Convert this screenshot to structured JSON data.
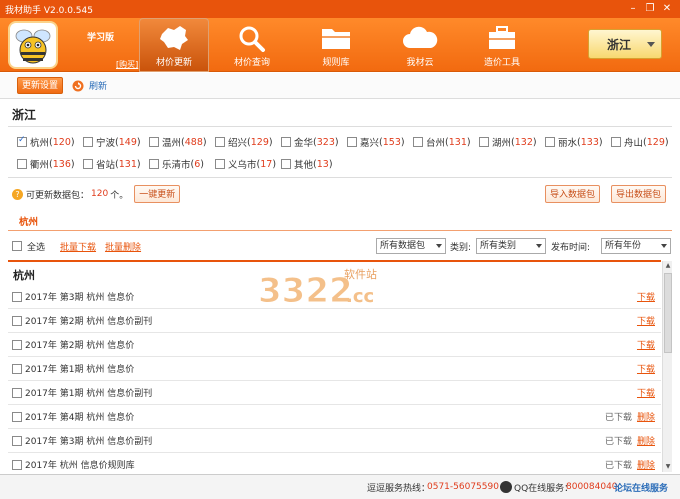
{
  "window": {
    "title": "我材助手 V2.0.0.545"
  },
  "header": {
    "edition": "学习版",
    "buy_label": "[购买]",
    "nav": [
      {
        "label": "材价更新",
        "icon": "china-map-icon",
        "active": true
      },
      {
        "label": "材价查询",
        "icon": "magnifier-icon",
        "active": false
      },
      {
        "label": "规则库",
        "icon": "folder-icon",
        "active": false
      },
      {
        "label": "我材云",
        "icon": "cloud-icon",
        "active": false
      },
      {
        "label": "造价工具",
        "icon": "toolbox-icon",
        "active": false
      }
    ],
    "region": "浙江"
  },
  "toolbar": {
    "settings_label": "更新设置",
    "refresh_label": "刷新"
  },
  "province": {
    "name": "浙江",
    "cities": [
      {
        "name": "杭州",
        "count": "120",
        "checked": true
      },
      {
        "name": "宁波",
        "count": "149",
        "checked": false
      },
      {
        "name": "温州",
        "count": "488",
        "checked": false
      },
      {
        "name": "绍兴",
        "count": "129",
        "checked": false
      },
      {
        "name": "金华",
        "count": "323",
        "checked": false
      },
      {
        "name": "嘉兴",
        "count": "153",
        "checked": false
      },
      {
        "name": "台州",
        "count": "131",
        "checked": false
      },
      {
        "name": "湖州",
        "count": "132",
        "checked": false
      },
      {
        "name": "丽水",
        "count": "133",
        "checked": false
      },
      {
        "name": "舟山",
        "count": "129",
        "checked": false
      },
      {
        "name": "衢州",
        "count": "136",
        "checked": false
      },
      {
        "name": "省站",
        "count": "131",
        "checked": false
      },
      {
        "name": "乐清市",
        "count": "6",
        "checked": false
      },
      {
        "name": "义乌市",
        "count": "17",
        "checked": false
      },
      {
        "name": "其他",
        "count": "13",
        "checked": false
      }
    ]
  },
  "package": {
    "prefix": "可更新数据包：",
    "count": "120",
    "suffix": "个。",
    "update_all_label": "一键更新",
    "import_label": "导入数据包",
    "export_label": "导出数据包"
  },
  "city_tab": "杭州",
  "filters": {
    "select_all_label": "全选",
    "batch_download_label": "批量下载",
    "batch_delete_label": "批量删除",
    "package_filter": "所有数据包",
    "category_label": "类别:",
    "category_value": "所有类别",
    "date_label": "发布时间:",
    "date_value": "所有年份"
  },
  "list": {
    "city": "杭州",
    "download_label": "下载",
    "downloaded_label": "已下载",
    "delete_label": "删除",
    "items": [
      {
        "title": "2017年 第3期 杭州 信息价",
        "downloaded": false
      },
      {
        "title": "2017年 第2期 杭州 信息价副刊",
        "downloaded": false
      },
      {
        "title": "2017年 第2期 杭州 信息价",
        "downloaded": false
      },
      {
        "title": "2017年 第1期 杭州 信息价",
        "downloaded": false
      },
      {
        "title": "2017年 第1期 杭州 信息价副刊",
        "downloaded": false
      },
      {
        "title": "2017年 第4期 杭州 信息价",
        "downloaded": true
      },
      {
        "title": "2017年 第3期 杭州 信息价副刊",
        "downloaded": true
      },
      {
        "title": "2017年 杭州 信息价规则库",
        "downloaded": true
      }
    ]
  },
  "watermark": {
    "number": "3322",
    "tld": ".cc",
    "text": "软件站"
  },
  "status": {
    "hotline_label": "逗逗服务热线：",
    "hotline_number": "0571-56075590",
    "qq_label": "QQ在线服务：",
    "qq_number": "800084040",
    "online_label": "论坛在线服务"
  },
  "colors": {
    "accent": "#e8540c",
    "count": "#e03c1c",
    "link": "#2a6cb8"
  }
}
